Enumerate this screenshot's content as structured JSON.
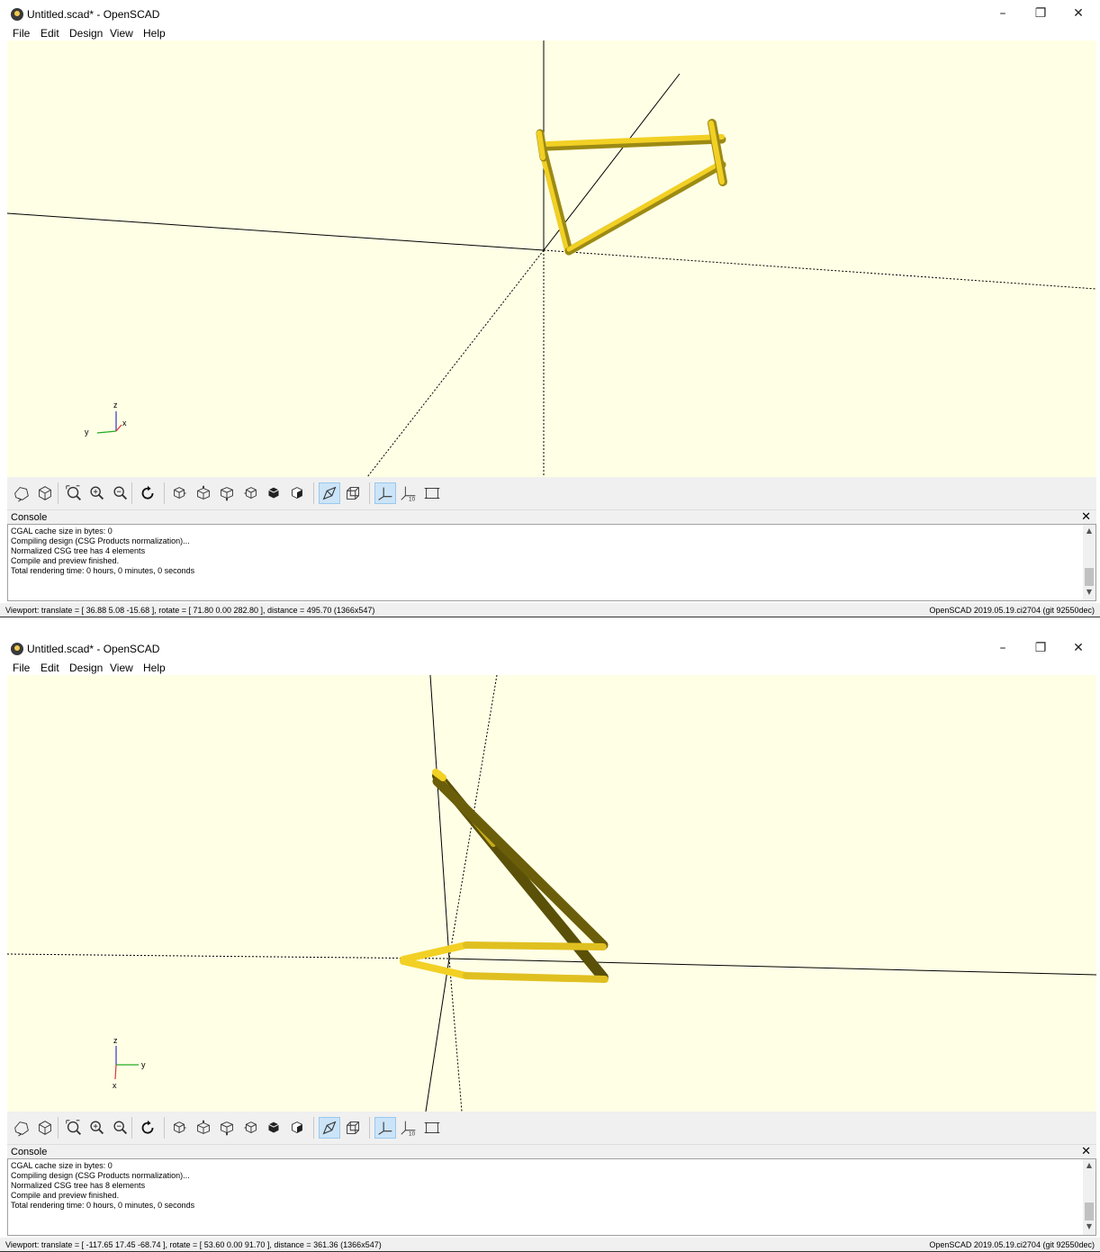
{
  "windows": [
    {
      "title": "Untitled.scad* - OpenSCAD",
      "menu": [
        "File",
        "Edit",
        "Design",
        "View",
        "Help"
      ],
      "axes_labels": {
        "z": "z",
        "y": "y",
        "x": "x"
      },
      "console": {
        "title": "Console",
        "lines": [
          "CGAL cache size in bytes: 0",
          "Compiling design (CSG Products normalization)...",
          "Normalized CSG tree has 4 elements",
          "Compile and preview finished.",
          "Total rendering time: 0 hours, 0 minutes, 0 seconds"
        ]
      },
      "status_left": "Viewport: translate = [ 36.88 5.08 -15.68 ], rotate = [ 71.80 0.00 282.80 ], distance = 495.70 (1366x547)",
      "status_right": "OpenSCAD 2019.05.19.ci2704 (git 92550dec)"
    },
    {
      "title": "Untitled.scad* - OpenSCAD",
      "menu": [
        "File",
        "Edit",
        "Design",
        "View",
        "Help"
      ],
      "axes_labels": {
        "z": "z",
        "y": "y",
        "x": "x"
      },
      "console": {
        "title": "Console",
        "lines": [
          "CGAL cache size in bytes: 0",
          "Compiling design (CSG Products normalization)...",
          "Normalized CSG tree has 8 elements",
          "Compile and preview finished.",
          "Total rendering time: 0 hours, 0 minutes, 0 seconds"
        ]
      },
      "status_left": "Viewport: translate = [ -117.65 17.45 -68.74 ], rotate = [ 53.60 0.00 91.70 ], distance = 361.36 (1366x547)",
      "status_right": "OpenSCAD 2019.05.19.ci2704 (git 92550dec)"
    }
  ],
  "window_controls": {
    "minimize": "–",
    "restore": "❐",
    "close": "✕"
  },
  "console_close": "✕",
  "toolbar_icons": [
    "render-icon",
    "preview-icon",
    "view-all-icon",
    "zoom-in-icon",
    "zoom-out-icon",
    "reset-view-icon",
    "view-right-icon",
    "view-top-icon",
    "view-bottom-icon",
    "view-left-icon",
    "view-front-icon",
    "view-back-icon",
    "perspective-icon",
    "orthogonal-icon",
    "show-axes-icon",
    "show-scale-icon",
    "show-edges-icon"
  ],
  "toolbar_active": [
    "perspective-icon",
    "show-axes-icon"
  ],
  "colors": {
    "viewport_bg": "#ffffe5",
    "model_yellow": "#f2d024",
    "model_shadow": "#8a7a10",
    "axis_x": "#d33",
    "axis_y": "#2a2",
    "axis_z": "#33c"
  }
}
